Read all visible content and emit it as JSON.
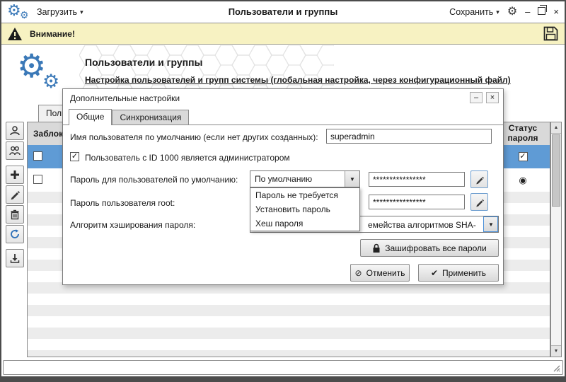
{
  "colors": {
    "accent": "#3b79b8",
    "selection": "#5f9bd5",
    "warning_bg": "#f7f2c2"
  },
  "titlebar": {
    "load": "Загрузить",
    "title": "Пользователи и группы",
    "save": "Сохранить"
  },
  "warning": {
    "text": "Внимание!"
  },
  "hero": {
    "title": "Пользователи и группы",
    "subtitle": "Настройка пользователей и групп системы (глобальная настройка, через конфигурационный файл)"
  },
  "main_tabs": {
    "users": "Поль"
  },
  "table": {
    "blocked_header": "Заблок",
    "status_header": "Статус пароля"
  },
  "dialog": {
    "title": "Дополнительные настройки",
    "tab_general": "Общие",
    "tab_sync": "Синхронизация",
    "username_label": "Имя пользователя по умолчанию (если нет других созданных):",
    "username_value": "superadmin",
    "admin_label": "Пользователь с ID 1000 является администратором",
    "default_password_label": "Пароль для пользователей по умолчанию:",
    "default_password_selected": "По умолчанию",
    "default_password_mask": "****************",
    "options": [
      "Пароль не требуется",
      "Установить пароль",
      "Хеш пароля"
    ],
    "root_password_label": "Пароль пользователя root:",
    "root_password_mask": "****************",
    "hash_label": "Алгоритм хэширования пароля:",
    "hash_visible_value": "емейства алгоритмов SHA-",
    "encrypt": "Зашифровать все пароли",
    "cancel": "Отменить",
    "apply": "Применить"
  },
  "glyphs": {
    "gear": "⚙",
    "caret_down": "▾",
    "combo_arrow": "▼",
    "scroll_up": "▲",
    "scroll_down": "▼",
    "minimize": "–",
    "close": "×",
    "check": "✓",
    "radio_selected": "◉",
    "cancel_icon": "⊘",
    "apply_icon": "✔"
  }
}
